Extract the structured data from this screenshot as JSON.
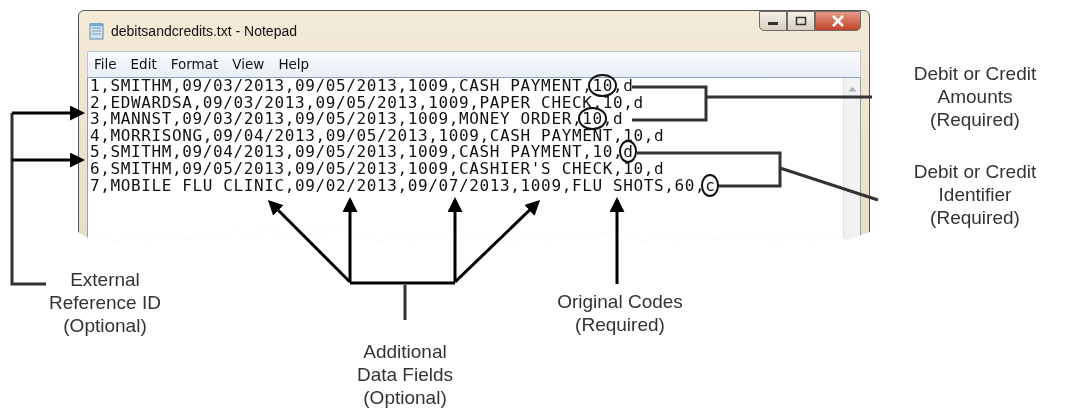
{
  "window": {
    "title": "debitsandcredits.txt - Notepad",
    "menu": [
      "File",
      "Edit",
      "Format",
      "View",
      "Help"
    ],
    "lines": [
      {
        "parts": [
          "1,SMITHM,09/03/2013,09/05/2013,1009,CASH PAYMENT,",
          "10",
          ",d"
        ]
      },
      {
        "parts": [
          "2,EDWARDSA,09/03/2013,09/05/2013,1009,PAPER CHECK,10,d"
        ]
      },
      {
        "parts": [
          "3,MANNST,09/03/2013,09/05/2013,1009,MONEY ORDER,",
          "10",
          ",d"
        ]
      },
      {
        "parts": [
          "4,MORRISONG,09/04/2013,09/05/2013,1009,CASH PAYMENT,10,d"
        ]
      },
      {
        "parts": [
          "5,SMITHM,09/04/2013,09/05/2013,1009,CASH PAYMENT,10,",
          "d"
        ]
      },
      {
        "parts": [
          "6,SMITHM,09/05/2013,09/05/2013,1009,CASHIER'S CHECK,10,d"
        ]
      },
      {
        "parts": [
          "7,MOBILE FLU CLINIC,09/02/2013,09/07/2013,1009,FLU SHOTS,60,",
          "c"
        ]
      }
    ]
  },
  "callouts": [
    {
      "kind": "amounts",
      "label": "Debit or Credit\nAmounts\n(Required)"
    },
    {
      "kind": "identifier",
      "label": "Debit or Credit\nIdentifier\n(Required)"
    },
    {
      "kind": "reference",
      "label": "External\nReference ID\n(Optional)"
    },
    {
      "kind": "additional",
      "label": "Additional\nData Fields\n(Optional)"
    },
    {
      "kind": "codes",
      "label": "Original Codes\n(Required)"
    }
  ]
}
